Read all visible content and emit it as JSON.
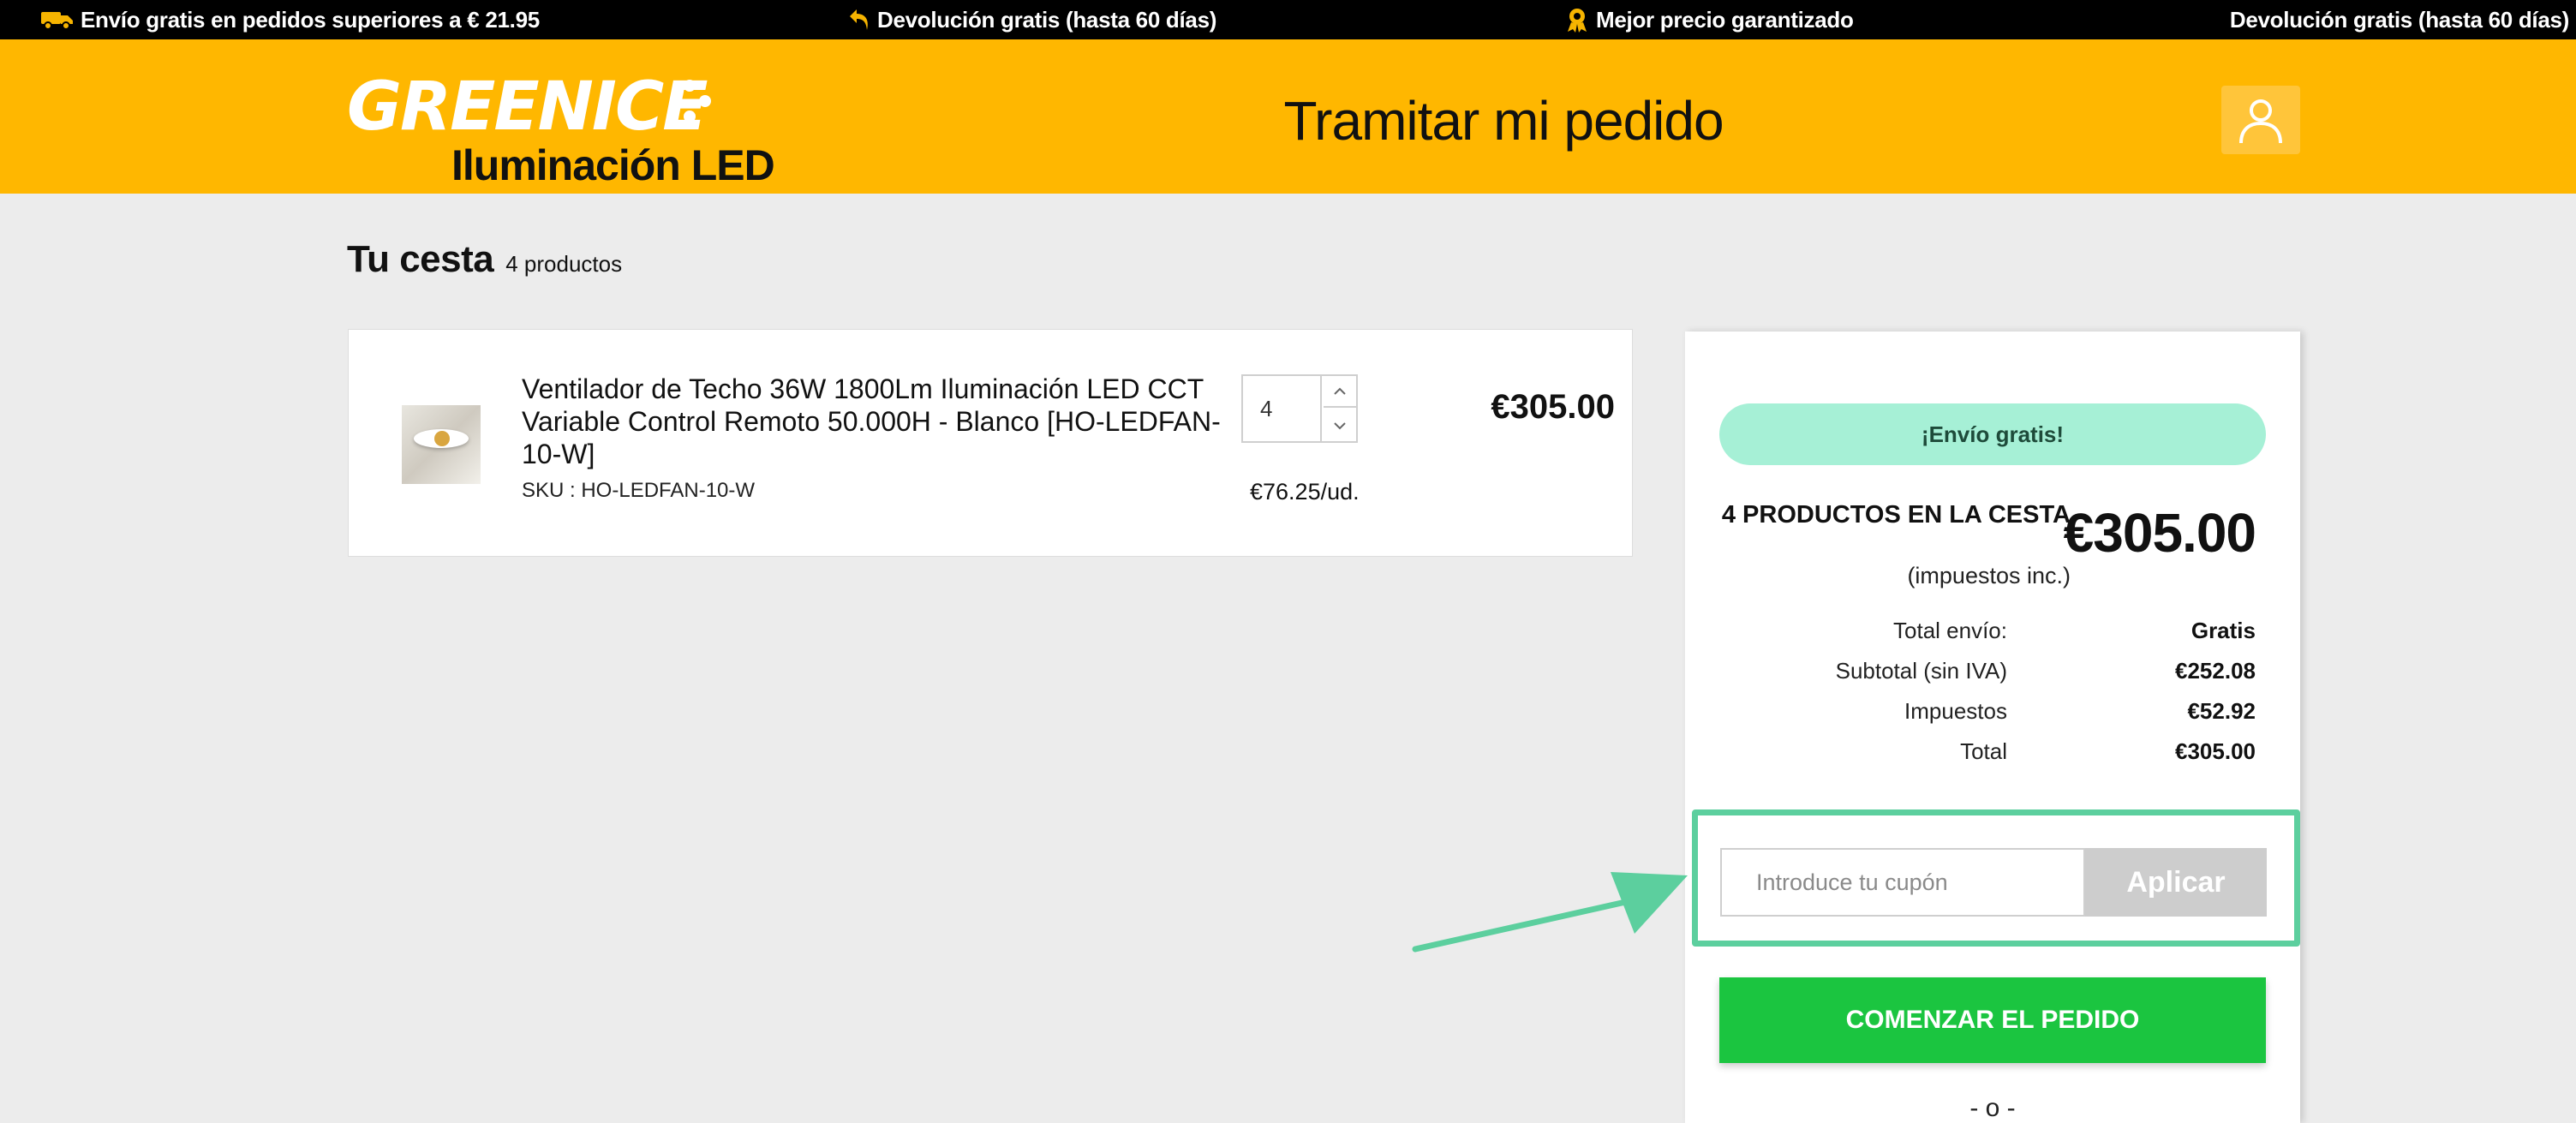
{
  "topbar": {
    "items": [
      {
        "icon": "truck-icon",
        "text": "Envío gratis en pedidos superiores a € 21.95"
      },
      {
        "icon": "return-arrow-icon",
        "text": "Devolución gratis (hasta 60 días)"
      },
      {
        "icon": "award-ribbon-icon",
        "text": "Mejor precio garantizado"
      },
      {
        "icon": "",
        "text": "Devolución gratis (hasta 60 días)"
      }
    ]
  },
  "header": {
    "logo_brand": "GREENICE",
    "logo_tagline": "Iluminación LED",
    "title": "Tramitar mi pedido",
    "account_icon": "user-icon"
  },
  "cart": {
    "heading": "Tu cesta",
    "count_label": "4 productos",
    "items": [
      {
        "name": "Ventilador de Techo 36W 1800Lm Iluminación LED CCT Variable Control Remoto 50.000H - Blanco [HO-LEDFAN-10-W]",
        "sku": "SKU : HO-LEDFAN-10-W",
        "quantity": "4",
        "unit_price": "€76.25/ud.",
        "total": "€305.00"
      }
    ]
  },
  "summary": {
    "free_shipping_badge": "¡Envío gratis!",
    "count_line": "4 PRODUCTOS EN LA CESTA",
    "tax_note": "(impuestos inc.)",
    "grand_total": "€305.00",
    "rows": [
      {
        "label": "Total envío:",
        "value": "Gratis"
      },
      {
        "label": "Subtotal (sin IVA)",
        "value": "€252.08"
      },
      {
        "label": "Impuestos",
        "value": "€52.92"
      },
      {
        "label": "Total",
        "value": "€305.00"
      }
    ],
    "coupon": {
      "placeholder": "Introduce tu cupón",
      "apply_label": "Aplicar"
    },
    "start_order_label": "COMENZAR EL PEDIDO",
    "separator": "- o -"
  },
  "colors": {
    "header_bg": "#ffb700",
    "topbar_bg": "#000000",
    "primary_green": "#1bc540",
    "highlight": "#5ccf9e",
    "free_ship_badge": "#a6f0d6"
  }
}
